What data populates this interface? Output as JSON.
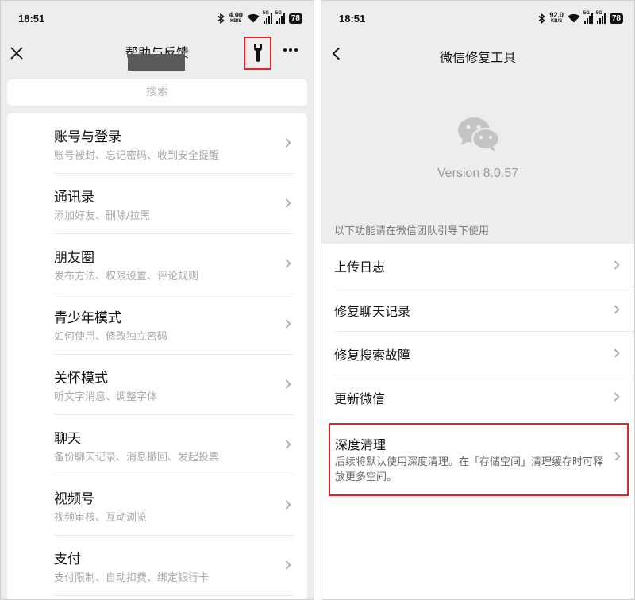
{
  "left": {
    "status": {
      "time": "18:51",
      "net_rate": "4.00",
      "net_unit": "KB/S",
      "sig1": "5G",
      "sig2": "5G",
      "battery": "78"
    },
    "header": {
      "title": "帮助与反馈"
    },
    "search": {
      "placeholder": "搜索"
    },
    "items": [
      {
        "title": "账号与登录",
        "subtitle": "账号被封、忘记密码、收到安全提醒"
      },
      {
        "title": "通讯录",
        "subtitle": "添加好友、删除/拉黑"
      },
      {
        "title": "朋友圈",
        "subtitle": "发布方法、权限设置、评论规则"
      },
      {
        "title": "青少年模式",
        "subtitle": "如何使用、修改独立密码"
      },
      {
        "title": "关怀模式",
        "subtitle": "听文字消息、调整字体"
      },
      {
        "title": "聊天",
        "subtitle": "备份聊天记录、消息撤回、发起投票"
      },
      {
        "title": "视频号",
        "subtitle": "视频审核、互动浏览"
      },
      {
        "title": "支付",
        "subtitle": "支付限制、自动扣费、绑定银行卡"
      }
    ]
  },
  "right": {
    "status": {
      "time": "18:51",
      "net_rate": "92.0",
      "net_unit": "KB/S",
      "sig1": "5G",
      "sig2": "5G",
      "battery": "78"
    },
    "header": {
      "title": "微信修复工具"
    },
    "version": "Version 8.0.57",
    "guide": "以下功能请在微信团队引导下使用",
    "tools": [
      "上传日志",
      "修复聊天记录",
      "修复搜索故障",
      "更新微信"
    ],
    "deep_clean": {
      "title": "深度清理",
      "desc": "后续将默认使用深度清理。在「存储空间」清理缓存时可释放更多空间。"
    }
  },
  "colors": {
    "highlight": "#d42a2d",
    "background": "#ededed",
    "logo": "#c4c4c4"
  }
}
